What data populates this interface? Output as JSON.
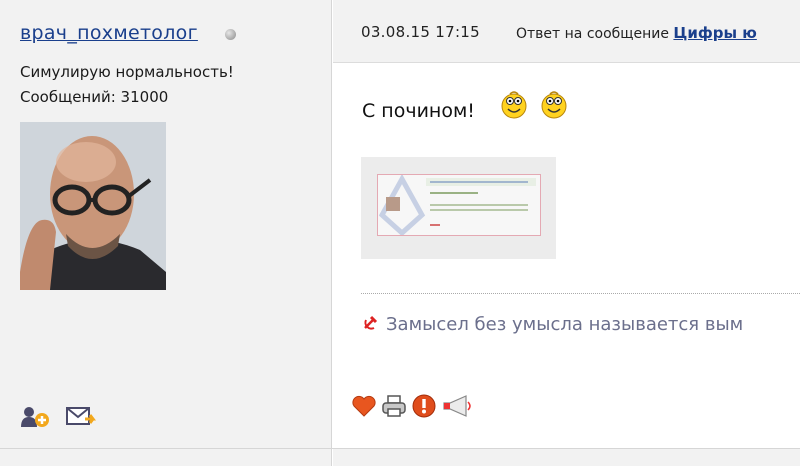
{
  "post": {
    "author": "врач_похметолог",
    "user_title": "Симулирую нормальность!",
    "post_count": "Сообщений: 31000",
    "date": "03.08.15 17:15",
    "reply_prefix": "Ответ на сообщение",
    "reply_link": "Цифры ю",
    "message": "С почином!",
    "signature": "Замысел без умысла называется вым"
  },
  "icons": {
    "status": "offline-status-dot",
    "left_actions": [
      "add-friend-icon",
      "send-message-icon"
    ],
    "post_actions": [
      "like-heart-icon",
      "print-icon",
      "report-icon",
      "megaphone-icon"
    ],
    "signature": "hammer-sickle-icon",
    "smiles": [
      "smile-icon",
      "smile-icon"
    ]
  },
  "colors": {
    "link": "#1a3f8c",
    "panel": "#f2f2f2",
    "signature_text": "#6b6f8c",
    "heart": "#e8561f"
  }
}
